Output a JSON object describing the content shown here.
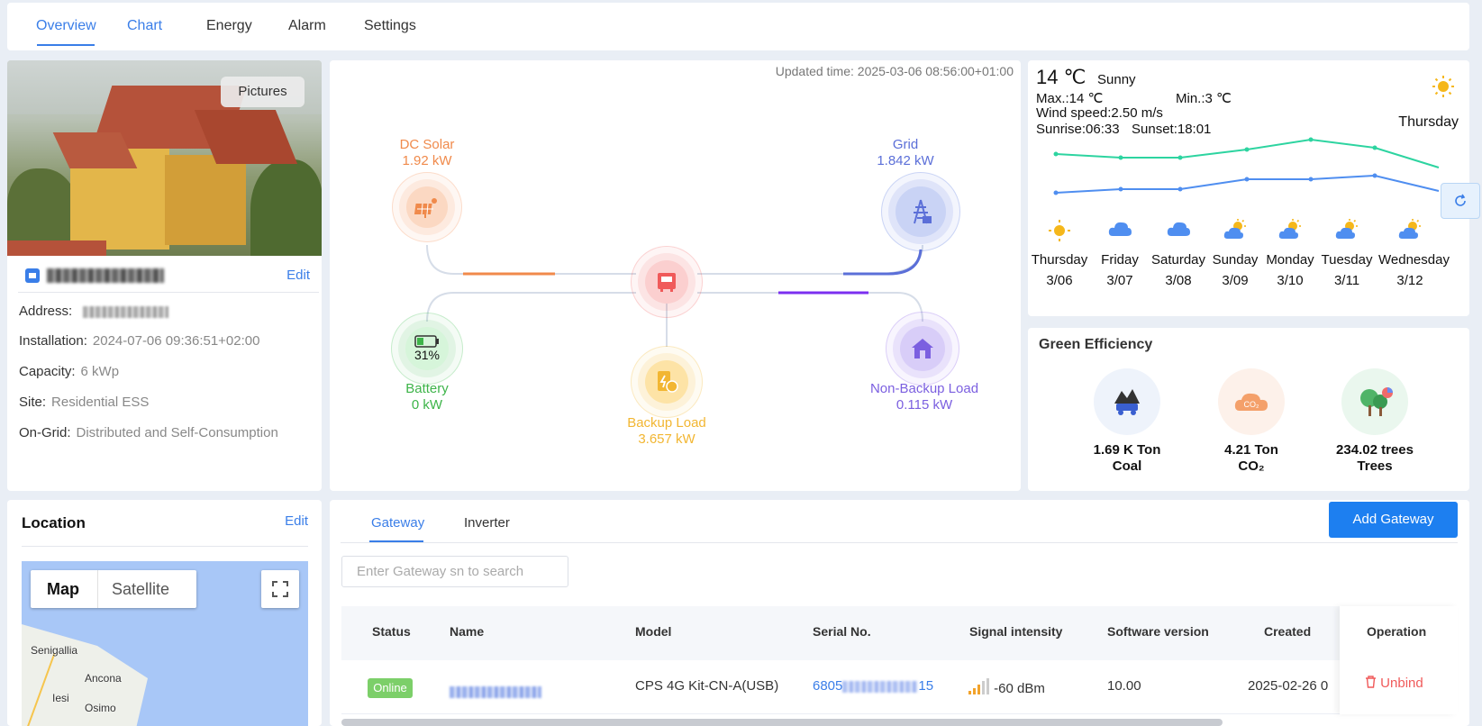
{
  "nav": {
    "tabs": [
      "Overview",
      "Chart",
      "Energy",
      "Alarm",
      "Settings"
    ]
  },
  "plant": {
    "pictures_label": "Pictures",
    "edit_label": "Edit",
    "address_label": "Address:",
    "installation_label": "Installation:",
    "installation_value": "2024-07-06 09:36:51+02:00",
    "capacity_label": "Capacity:",
    "capacity_value": "6 kWp",
    "site_label": "Site:",
    "site_value": "Residential ESS",
    "ongrid_label": "On-Grid:",
    "ongrid_value": "Distributed and Self-Consumption"
  },
  "flow": {
    "updated": "Updated time: 2025-03-06 08:56:00+01:00",
    "solar": {
      "name": "DC Solar",
      "value": "1.92 kW"
    },
    "grid": {
      "name": "Grid",
      "value": "1.842 kW"
    },
    "battery": {
      "name": "Battery",
      "value": "0 kW",
      "soc": "31%"
    },
    "backup": {
      "name": "Backup Load",
      "value": "3.657 kW"
    },
    "nonbackup": {
      "name": "Non-Backup Load",
      "value": "0.115 kW"
    },
    "colors": {
      "solar": "#f08a4b",
      "grid": "#5b6fd8",
      "battery": "#3db449",
      "backup": "#f2b632",
      "nonbackup": "#7b5fe0",
      "inverter": "#f05a5a"
    }
  },
  "weather": {
    "temp": "14 ℃",
    "condition": "Sunny",
    "max": "Max.:14 ℃",
    "min": "Min.:3 ℃",
    "wind": "Wind speed:2.50 m/s",
    "sunrise": "Sunrise:06:33",
    "sunset": "Sunset:18:01",
    "today": "Thursday",
    "days": [
      {
        "name": "Thursday",
        "date": "3/06",
        "icon": "sun-icon"
      },
      {
        "name": "Friday",
        "date": "3/07",
        "icon": "cloud-icon"
      },
      {
        "name": "Saturday",
        "date": "3/08",
        "icon": "cloud-icon"
      },
      {
        "name": "Sunday",
        "date": "3/09",
        "icon": "partly-cloudy-icon"
      },
      {
        "name": "Monday",
        "date": "3/10",
        "icon": "partly-cloudy-icon"
      },
      {
        "name": "Tuesday",
        "date": "3/11",
        "icon": "partly-cloudy-icon"
      },
      {
        "name": "Wednesday",
        "date": "3/12",
        "icon": "partly-cloudy-icon"
      }
    ]
  },
  "green": {
    "title": "Green Efficiency",
    "items": [
      {
        "value": "1.69 K Ton",
        "label": "Coal",
        "icon": "coal-icon"
      },
      {
        "value": "4.21 Ton",
        "label": "CO₂",
        "icon": "co2-icon"
      },
      {
        "value": "234.02 trees",
        "label": "Trees",
        "icon": "trees-icon"
      }
    ]
  },
  "location": {
    "title": "Location",
    "edit_label": "Edit",
    "map_label": "Map",
    "satellite_label": "Satellite",
    "cities": [
      "Senigallia",
      "Ancona",
      "Iesi",
      "Osimo"
    ]
  },
  "gateway": {
    "tabs": [
      "Gateway",
      "Inverter"
    ],
    "add_label": "Add Gateway",
    "search_placeholder": "Enter Gateway sn to search",
    "columns": [
      "Status",
      "Name",
      "Model",
      "Serial No.",
      "Signal intensity",
      "Software version",
      "Created",
      "Operation"
    ],
    "rows": [
      {
        "status": "Online",
        "model": "CPS 4G Kit-CN-A(USB)",
        "serial_prefix": "6805",
        "serial_suffix": "15",
        "signal": "-60 dBm",
        "software": "10.00",
        "created": "2025-02-26 0",
        "operation": "Unbind"
      }
    ]
  }
}
